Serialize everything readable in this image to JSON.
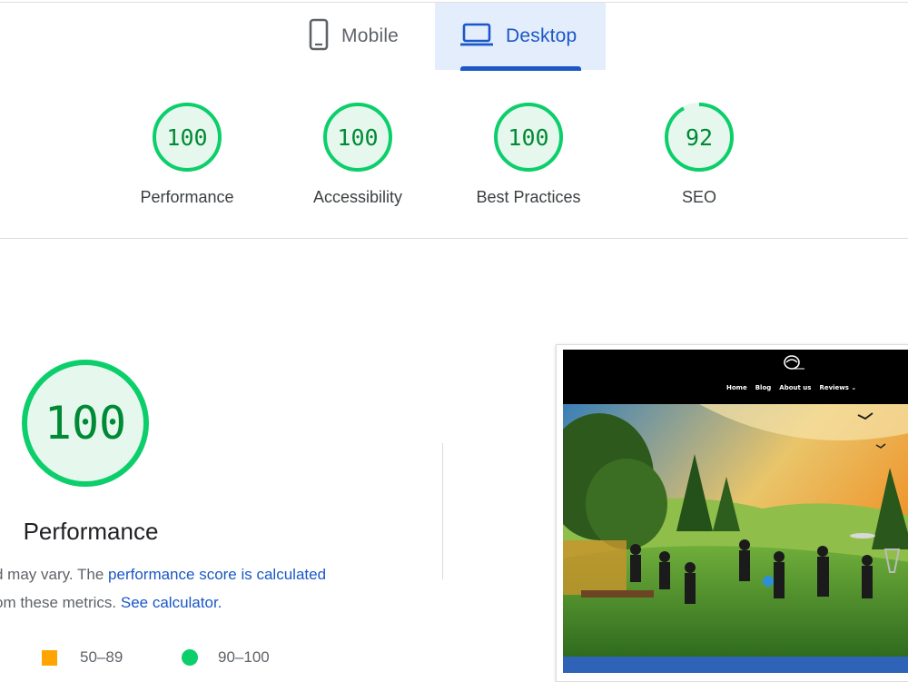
{
  "tabs": [
    {
      "label": "Mobile",
      "icon": "phone-icon",
      "selected": false
    },
    {
      "label": "Desktop",
      "icon": "laptop-icon",
      "selected": true
    }
  ],
  "scores": [
    {
      "value": "100",
      "label": "Performance",
      "fraction": 1.0
    },
    {
      "value": "100",
      "label": "Accessibility",
      "fraction": 1.0
    },
    {
      "value": "100",
      "label": "Best Practices",
      "fraction": 1.0
    },
    {
      "value": "92",
      "label": "SEO",
      "fraction": 0.92
    }
  ],
  "performance": {
    "score": "100",
    "title": "Performance",
    "desc_text_1": "d may vary. The ",
    "desc_link_1": "performance score is calculated",
    "desc_text_2": "om these metrics. ",
    "desc_link_2": "See calculator."
  },
  "legend": [
    {
      "range": "50–89",
      "color": "#ffa400",
      "shape": "square"
    },
    {
      "range": "90–100",
      "color": "#0cce6b",
      "shape": "circle"
    }
  ],
  "thumbnail": {
    "nav_items": [
      "Home",
      "Blog",
      "About us",
      "Reviews ⌄"
    ]
  },
  "colors": {
    "good": "#0cce6b",
    "good_text": "#008a35",
    "good_bg": "#e6f8ee",
    "accent": "#1a57c7",
    "average": "#ffa400"
  }
}
